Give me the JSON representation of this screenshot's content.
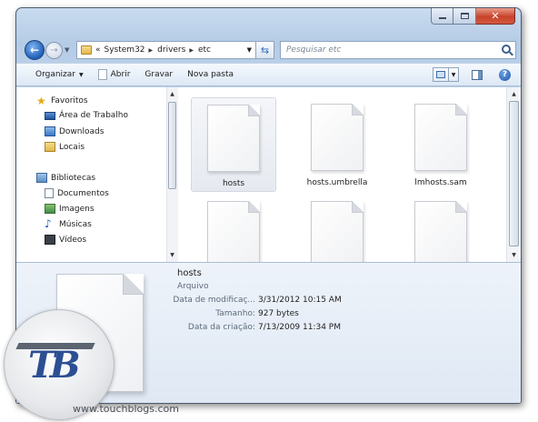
{
  "window": {
    "caption_buttons": {
      "minimize": "minimize-icon",
      "maximize": "maximize-icon",
      "close": "✕"
    }
  },
  "navbar": {
    "back_icon": "back-arrow-icon",
    "forward_icon": "forward-arrow-icon",
    "breadcrumb": {
      "overflow": "«",
      "segments": [
        "System32",
        "drivers",
        "etc"
      ]
    },
    "search_placeholder": "Pesquisar etc"
  },
  "toolbar": {
    "organize_label": "Organizar",
    "open_label": "Abrir",
    "burn_label": "Gravar",
    "new_folder_label": "Nova pasta"
  },
  "sidebar": {
    "favorites": {
      "label": "Favoritos",
      "items": [
        "Área de Trabalho",
        "Downloads",
        "Locais"
      ]
    },
    "libraries": {
      "label": "Bibliotecas",
      "items": [
        "Documentos",
        "Imagens",
        "Músicas",
        "Vídeos"
      ]
    }
  },
  "files": [
    {
      "name": "hosts",
      "selected": true
    },
    {
      "name": "hosts.umbrella",
      "selected": false
    },
    {
      "name": "lmhosts.sam",
      "selected": false
    },
    {
      "name": "",
      "selected": false
    },
    {
      "name": "",
      "selected": false
    },
    {
      "name": "",
      "selected": false
    }
  ],
  "details": {
    "name": "hosts",
    "type": "Arquivo",
    "rows": [
      {
        "label": "Data de modificaç...",
        "value": "3/31/2012 10:15 AM"
      },
      {
        "label": "Tamanho:",
        "value": "927 bytes"
      },
      {
        "label": "Data da criação:",
        "value": "7/13/2009 11:34 PM"
      }
    ]
  },
  "watermark": {
    "logo_text": "TB",
    "url": "www.touchblogs.com"
  },
  "colors": {
    "window_frame": "#b4cbe6",
    "close_button": "#c7432b",
    "accent_blue": "#1f5fb8",
    "logo_blue": "#2c4f93"
  }
}
